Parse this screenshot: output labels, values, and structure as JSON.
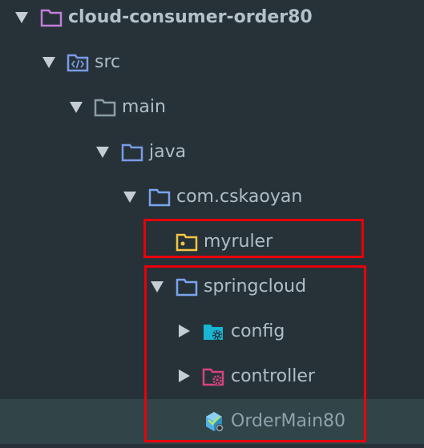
{
  "project_tree": {
    "nodes": [
      {
        "label": "cloud-consumer-order80",
        "icon": "module-folder-icon",
        "expanded": true
      },
      {
        "label": "src",
        "icon": "source-folder-icon",
        "expanded": true
      },
      {
        "label": "main",
        "icon": "folder-icon",
        "expanded": true
      },
      {
        "label": "java",
        "icon": "source-root-folder-icon",
        "expanded": true
      },
      {
        "label": "com.cskaoyan",
        "icon": "package-folder-icon",
        "expanded": true
      },
      {
        "label": "myruler",
        "icon": "package-icon",
        "expanded": false
      },
      {
        "label": "springcloud",
        "icon": "package-folder-icon",
        "expanded": true
      },
      {
        "label": "config",
        "icon": "config-folder-icon",
        "expanded": false
      },
      {
        "label": "controller",
        "icon": "controller-folder-icon",
        "expanded": false
      },
      {
        "label": "OrderMain80",
        "icon": "spring-boot-class-icon",
        "selected": true
      }
    ]
  },
  "colors": {
    "background": "#263238",
    "selected_row": "#314549",
    "text": "#b0bec5",
    "highlight_box": "#e8000b",
    "module_folder": "#c47ed9",
    "source_folder": "#7b9be6",
    "package_folder": "#7aa4ee",
    "package_icon": "#f5c542",
    "config_icon": "#19b5d4",
    "controller_icon": "#d8437f"
  }
}
